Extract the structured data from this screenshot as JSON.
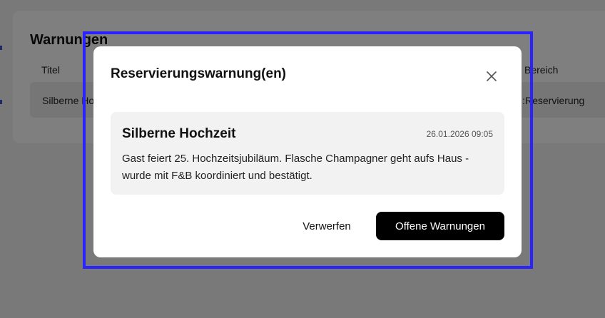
{
  "background": {
    "section_title": "Warnungen",
    "columns": [
      "Titel",
      "Bereich"
    ],
    "rows": [
      {
        "title": "Silberne Ho",
        "area": "Reservierung",
        "area_prefix": ":"
      }
    ]
  },
  "modal": {
    "title": "Reservierungswarnung(en)",
    "close_icon": "close-icon",
    "warning": {
      "title": "Silberne Hochzeit",
      "timestamp": "26.01.2026 09:05",
      "text": "Gast feiert 25. Hochzeitsjubiläum. Flasche Champagner geht aufs Haus - wurde mit F&B koordiniert und bestätigt."
    },
    "buttons": {
      "discard": "Verwerfen",
      "open_warnings": "Offene Warnungen"
    }
  },
  "colors": {
    "highlight": "#2a22ff",
    "primary_button": "#000000",
    "card_bg": "#f2f2f2"
  }
}
